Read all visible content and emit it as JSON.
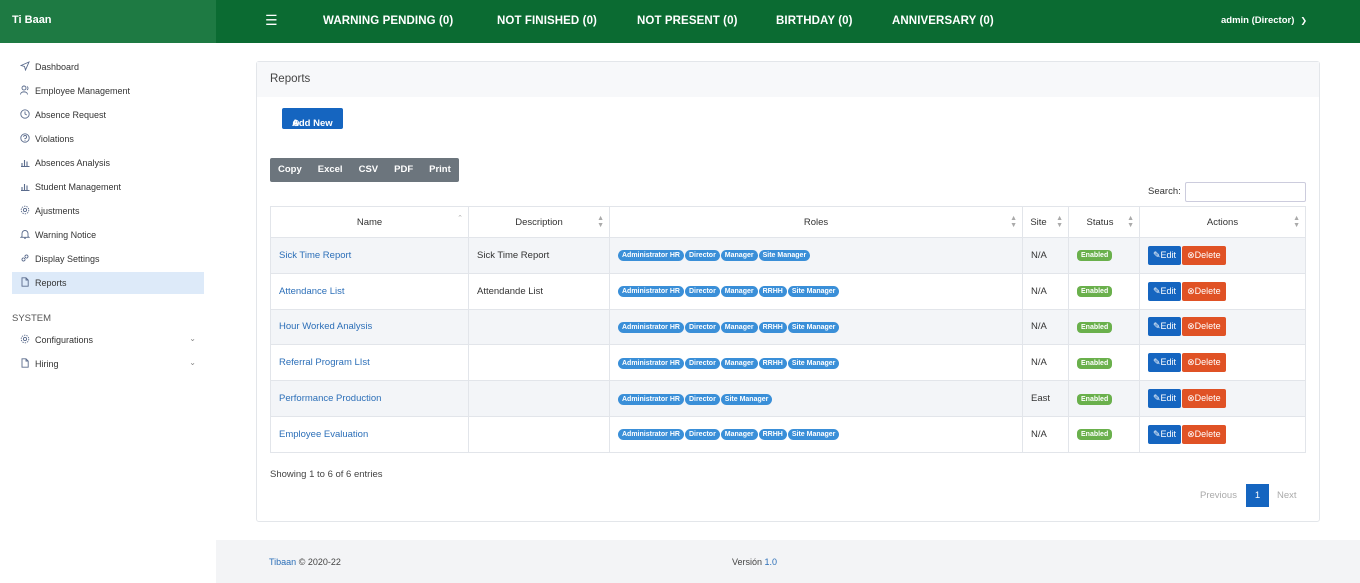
{
  "brand": "Ti Baan",
  "topnav": {
    "warning": "WARNING PENDING (0)",
    "not_finished": "NOT FINISHED (0)",
    "not_present": "NOT PRESENT (0)",
    "birthday": "BIRTHDAY (0)",
    "anniversary": "ANNIVERSARY (0)",
    "user": "admin (Director)"
  },
  "sidebar": {
    "items": [
      {
        "label": "Dashboard",
        "icon": "send-icon"
      },
      {
        "label": "Employee Management",
        "icon": "users-icon"
      },
      {
        "label": "Absence Request",
        "icon": "clock-icon"
      },
      {
        "label": "Violations",
        "icon": "help-circle-icon"
      },
      {
        "label": "Absences Analysis",
        "icon": "bar-chart-icon"
      },
      {
        "label": "Student Management",
        "icon": "bar-chart-icon"
      },
      {
        "label": "Ajustments",
        "icon": "gear-icon"
      },
      {
        "label": "Warning Notice",
        "icon": "bell-icon"
      },
      {
        "label": "Display Settings",
        "icon": "link-icon"
      },
      {
        "label": "Reports",
        "icon": "file-icon"
      }
    ],
    "section": "SYSTEM",
    "system_items": [
      {
        "label": "Configurations",
        "icon": "gear-icon"
      },
      {
        "label": "Hiring",
        "icon": "file-icon"
      }
    ]
  },
  "card": {
    "title": "Reports",
    "add_new": "Add New",
    "export": [
      "Copy",
      "Excel",
      "CSV",
      "PDF",
      "Print"
    ],
    "search_label": "Search:"
  },
  "table": {
    "headers": {
      "name": "Name",
      "description": "Description",
      "roles": "Roles",
      "site": "Site",
      "status": "Status",
      "actions": "Actions"
    },
    "rows": [
      {
        "name": "Sick Time Report",
        "description": "Sick Time Report",
        "roles": [
          "Administrator HR",
          "Director",
          "Manager",
          "Site Manager"
        ],
        "site": "N/A",
        "status": "Enabled"
      },
      {
        "name": "Attendance List",
        "description": "Attendande List",
        "roles": [
          "Administrator HR",
          "Director",
          "Manager",
          "RRHH",
          "Site Manager"
        ],
        "site": "N/A",
        "status": "Enabled"
      },
      {
        "name": "Hour Worked Analysis",
        "description": "",
        "roles": [
          "Administrator HR",
          "Director",
          "Manager",
          "RRHH",
          "Site Manager"
        ],
        "site": "N/A",
        "status": "Enabled"
      },
      {
        "name": "Referral Program LIst",
        "description": "",
        "roles": [
          "Administrator HR",
          "Director",
          "Manager",
          "RRHH",
          "Site Manager"
        ],
        "site": "N/A",
        "status": "Enabled"
      },
      {
        "name": "Performance Production",
        "description": "",
        "roles": [
          "Administrator HR",
          "Director",
          "Site Manager"
        ],
        "site": "East",
        "status": "Enabled"
      },
      {
        "name": "Employee Evaluation",
        "description": "",
        "roles": [
          "Administrator HR",
          "Director",
          "Manager",
          "RRHH",
          "Site Manager"
        ],
        "site": "N/A",
        "status": "Enabled"
      }
    ],
    "edit_label": "Edit",
    "delete_label": "Delete"
  },
  "pagination": {
    "info": "Showing 1 to 6 of 6 entries",
    "previous": "Previous",
    "current": "1",
    "next": "Next"
  },
  "footer": {
    "brand_link": "Tibaan",
    "copyright": "© 2020-22",
    "version_label": "Versión",
    "version": "1.0"
  },
  "colors": {
    "topbar": "#0b6b32",
    "brand_bg": "#1e7a43",
    "primary": "#1565c0",
    "danger": "#e05225",
    "badge": "#3a8fd8",
    "status": "#6ab04c"
  }
}
